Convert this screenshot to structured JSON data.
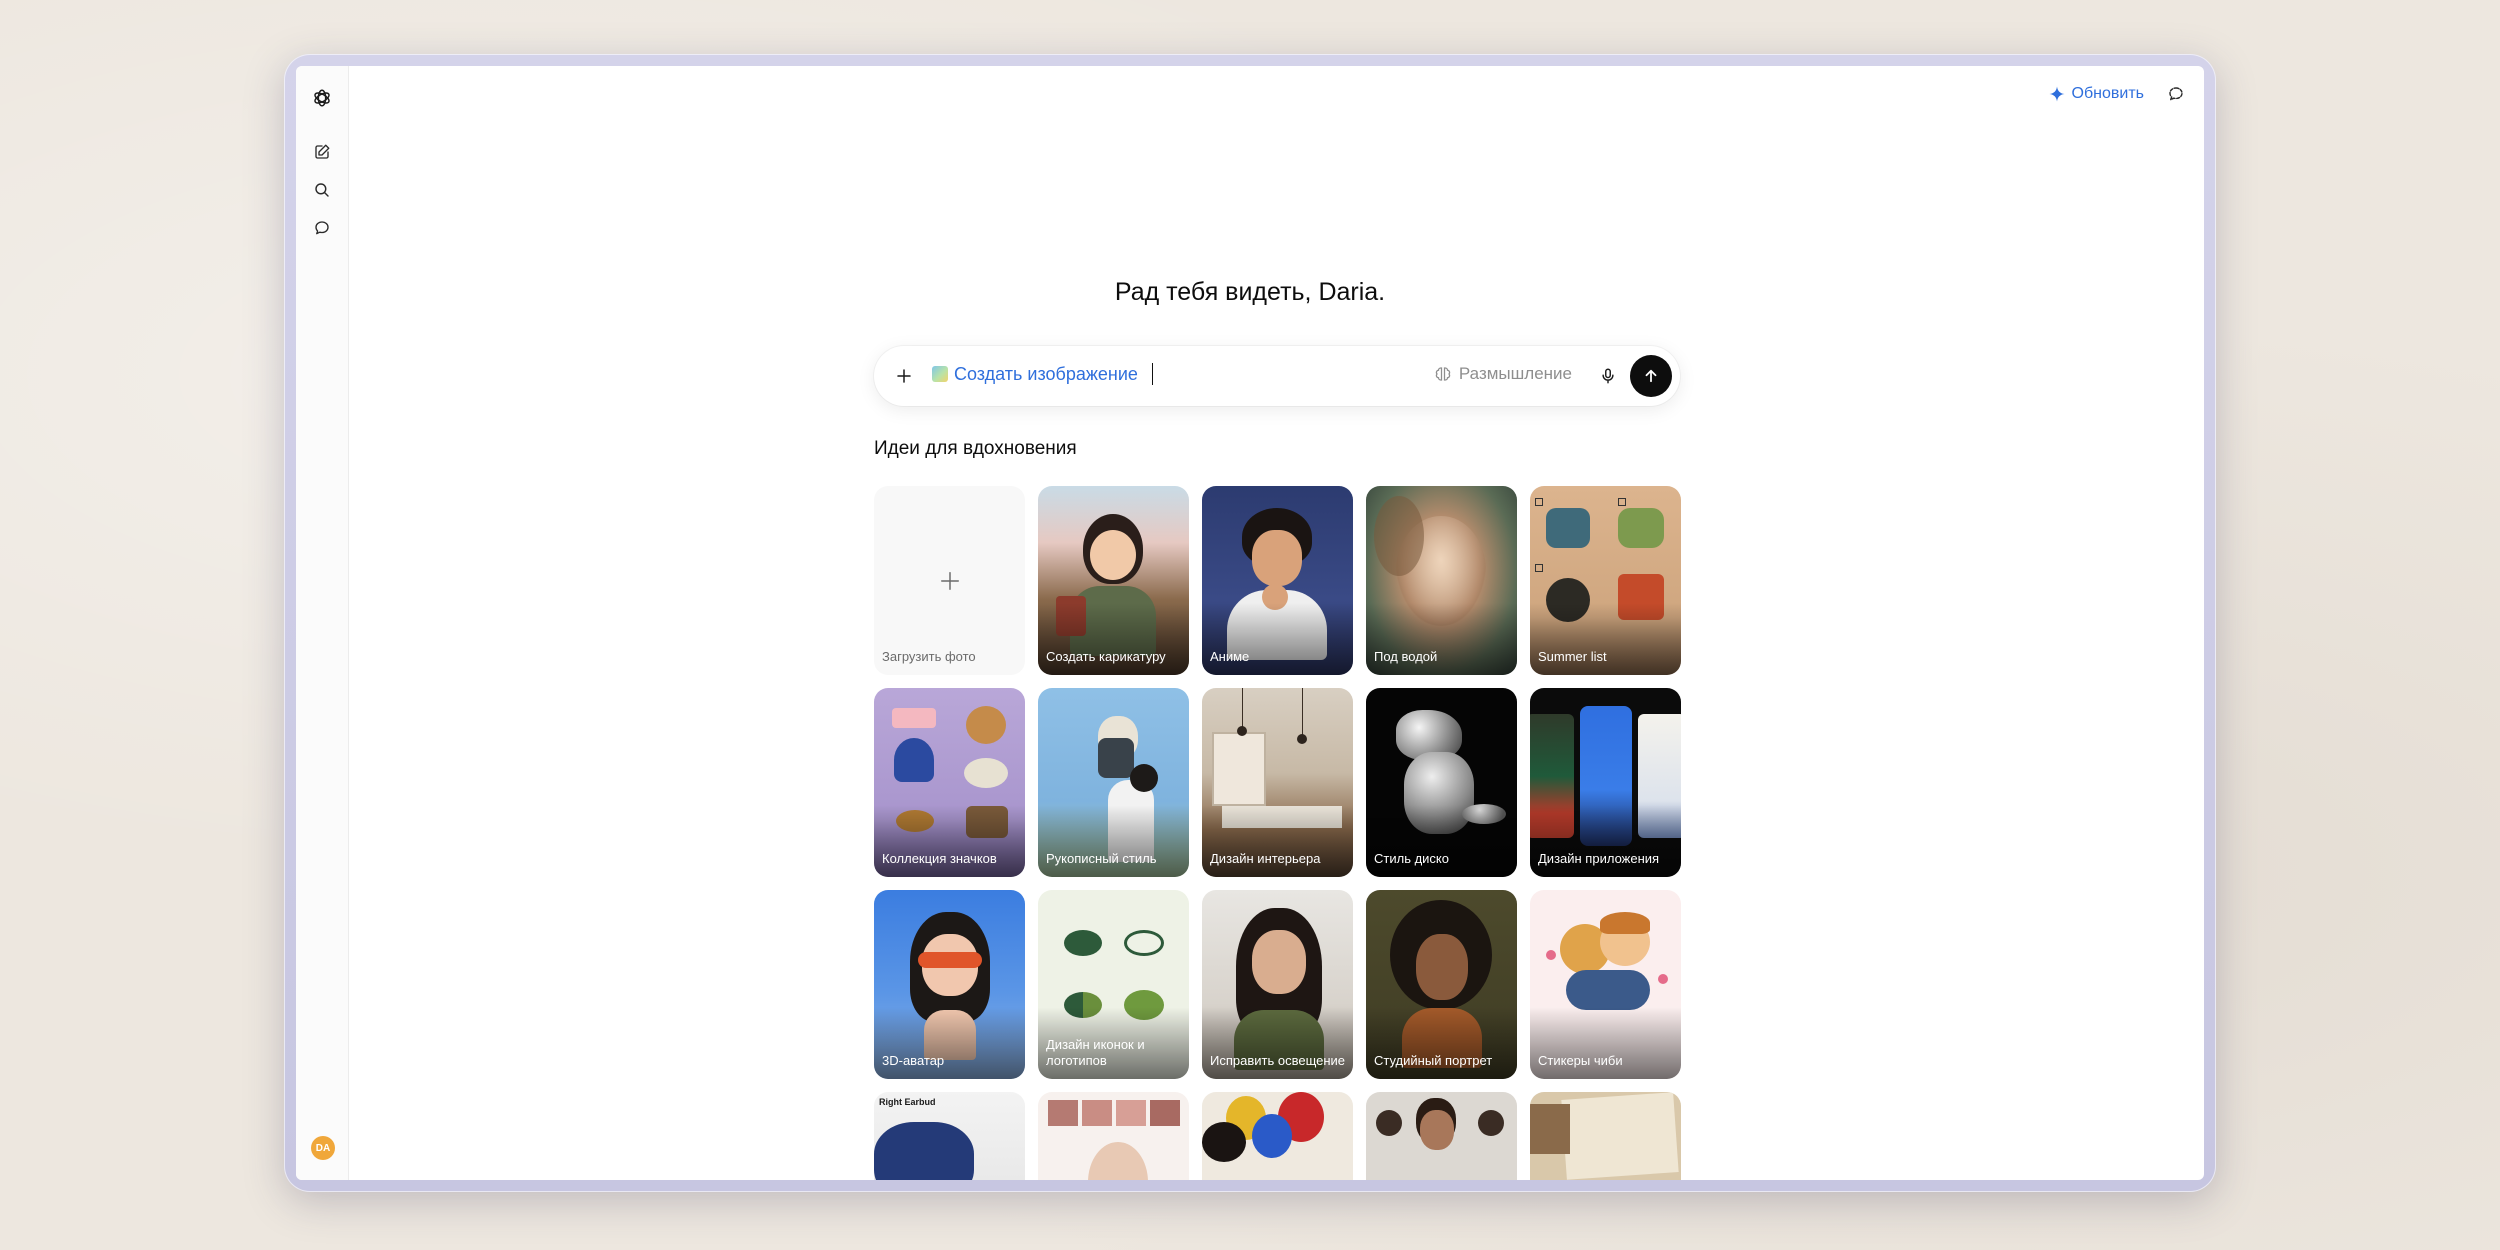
{
  "header": {
    "upgrade_label": "Обновить"
  },
  "sidebar": {
    "avatar_initials": "DA"
  },
  "greeting": "Рад тебя видеть, Daria.",
  "composer": {
    "chip_label": "Создать изображение",
    "think_label": "Размышление"
  },
  "section_title": "Идеи для вдохновения",
  "cards": [
    {
      "label": "Загрузить фото"
    },
    {
      "label": "Создать карикатуру"
    },
    {
      "label": "Аниме"
    },
    {
      "label": "Под водой"
    },
    {
      "label": "Summer list"
    },
    {
      "label": "Коллекция значков"
    },
    {
      "label": "Рукописный стиль"
    },
    {
      "label": "Дизайн интерьера"
    },
    {
      "label": "Стиль диско"
    },
    {
      "label": "Дизайн приложения"
    },
    {
      "label": "3D-аватар"
    },
    {
      "label": "Дизайн иконок и логотипов"
    },
    {
      "label": "Исправить освещение"
    },
    {
      "label": "Студийный портрет"
    },
    {
      "label": "Стикеры чиби"
    },
    {
      "label": "Right Earbud"
    },
    {
      "label": ""
    },
    {
      "label": ""
    },
    {
      "label": ""
    },
    {
      "label": ""
    }
  ],
  "colors": {
    "accent": "#2f6fdc",
    "send_button": "#0d0d0d",
    "avatar": "#f0a73a"
  }
}
